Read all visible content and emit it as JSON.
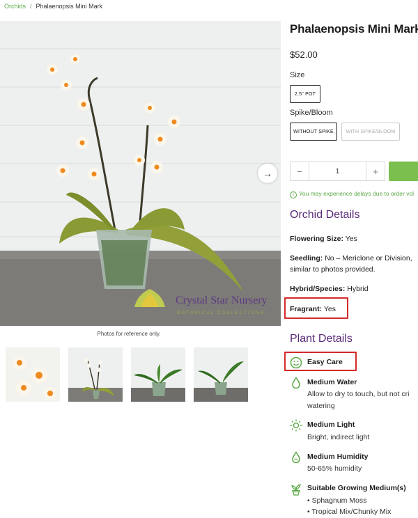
{
  "breadcrumb": {
    "root": "Orchids",
    "separator": "/",
    "current": "Phalaenopsis Mini Mark"
  },
  "gallery": {
    "watermark_name": "Crystal Star Nursery",
    "watermark_sub": "BOTANICAL COLLECTIONS",
    "caption": "Photos for reference only.",
    "thumb_count": 4
  },
  "product": {
    "title": "Phalaenopsis Mini Mark",
    "price": "$52.00",
    "size_label": "Size",
    "size_options": [
      "2.5\" POT"
    ],
    "spike_label": "Spike/Bloom",
    "spike_options": [
      "WITHOUT SPIKE",
      "WITH SPIKE/BLOOM"
    ],
    "quantity": "1",
    "qty_minus": "−",
    "qty_plus": "+",
    "notice": "You may experience delays due to order vol"
  },
  "orchid_details": {
    "heading": "Orchid Details",
    "flowering_size_label": "Flowering Size:",
    "flowering_size_value": "Yes",
    "seedling_label": "Seedling:",
    "seedling_value": "No – Mericlone or Division,",
    "seedling_value_2": "similar to photos provided.",
    "hybrid_label": "Hybrid/Species:",
    "hybrid_value": "Hybrid",
    "fragrant_label": "Fragrant:",
    "fragrant_value": "Yes"
  },
  "plant_details": {
    "heading": "Plant Details",
    "easy_care": "Easy Care",
    "water_title": "Medium Water",
    "water_text_1": "Allow to dry to touch, but not cri",
    "water_text_2": "watering",
    "light_title": "Medium Light",
    "light_text": "Bright, indirect light",
    "humidity_title": "Medium Humidity",
    "humidity_text": "50-65% humidity",
    "medium_title": "Suitable Growing Medium(s)",
    "medium_items": [
      "• Sphagnum Moss",
      "• Tropical Mix/Chunky Mix"
    ]
  },
  "colors": {
    "accent_green": "#5aa845",
    "heading_purple": "#5a2a78",
    "highlight_red": "#d42a2a",
    "add_button": "#7bbf4f"
  },
  "icons": [
    "arrow-right-icon",
    "info-icon",
    "smiley-icon",
    "water-drop-icon",
    "sun-icon",
    "humidity-icon",
    "plant-pot-icon"
  ]
}
